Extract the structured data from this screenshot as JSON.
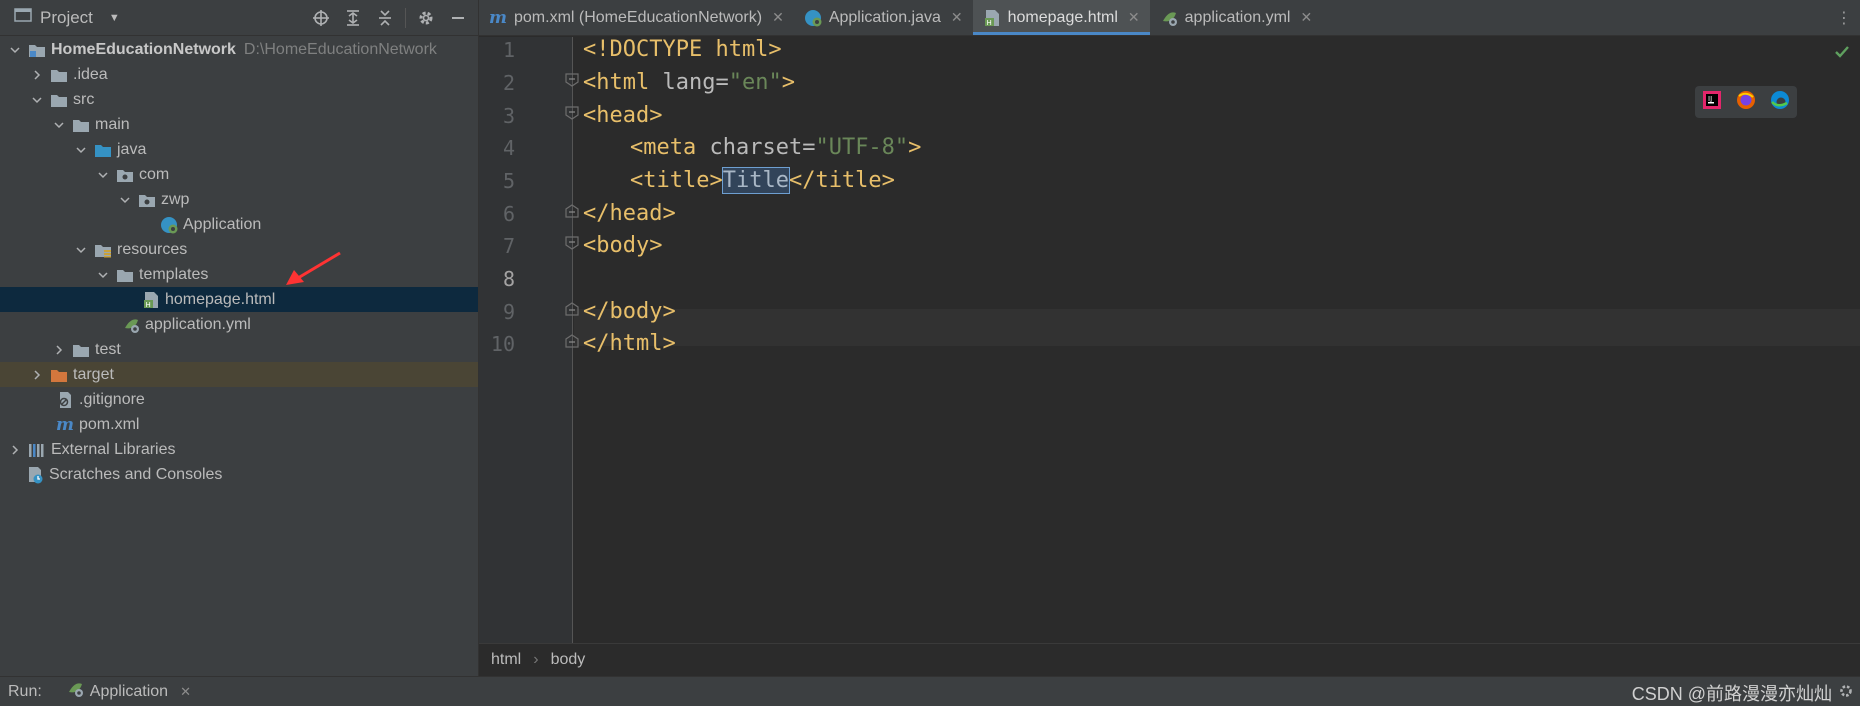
{
  "project_pane": {
    "title": "Project",
    "tools": [
      "locate-icon",
      "expand-all-icon",
      "collapse-all-icon",
      "gear-icon",
      "hide-icon"
    ],
    "tree": [
      {
        "label": "HomeEducationNetwork",
        "hint": "D:\\HomeEducationNetwork",
        "icon": "module-folder-icon"
      },
      {
        "label": ".idea",
        "icon": "folder-icon"
      },
      {
        "label": "src",
        "icon": "folder-icon"
      },
      {
        "label": "main",
        "icon": "folder-icon"
      },
      {
        "label": "java",
        "icon": "source-folder-icon"
      },
      {
        "label": "com",
        "icon": "package-icon"
      },
      {
        "label": "zwp",
        "icon": "package-icon"
      },
      {
        "label": "Application",
        "icon": "spring-boot-class-icon"
      },
      {
        "label": "resources",
        "icon": "resources-folder-icon"
      },
      {
        "label": "templates",
        "icon": "folder-icon"
      },
      {
        "label": "homepage.html",
        "icon": "html-file-icon"
      },
      {
        "label": "application.yml",
        "icon": "yaml-file-icon"
      },
      {
        "label": "test",
        "icon": "folder-icon"
      },
      {
        "label": "target",
        "icon": "excluded-folder-icon"
      },
      {
        "label": ".gitignore",
        "icon": "gitignore-file-icon"
      },
      {
        "label": "pom.xml",
        "icon": "maven-icon"
      },
      {
        "label": "External Libraries",
        "icon": "libraries-icon"
      },
      {
        "label": "Scratches and Consoles",
        "icon": "scratches-icon"
      }
    ]
  },
  "tabs": [
    {
      "label": "pom.xml (HomeEducationNetwork)",
      "icon": "maven-icon",
      "active": false
    },
    {
      "label": "Application.java",
      "icon": "spring-boot-class-icon",
      "active": false
    },
    {
      "label": "homepage.html",
      "icon": "html-file-icon",
      "active": true
    },
    {
      "label": "application.yml",
      "icon": "yaml-file-icon",
      "active": false
    }
  ],
  "editor": {
    "line_numbers": [
      "1",
      "2",
      "3",
      "4",
      "5",
      "6",
      "7",
      "8",
      "9",
      "10"
    ],
    "current_line": "8",
    "code": {
      "l1_tag": "<!DOCTYPE html>",
      "l2_open": "<html",
      "l2_attr": " lang=",
      "l2_val": "\"en\"",
      "l2_close": ">",
      "l3": "<head>",
      "l4_open": "<meta",
      "l4_attr": " charset=",
      "l4_val": "\"UTF-8\"",
      "l4_close": ">",
      "l5_open": "<title>",
      "l5_text": "Title",
      "l5_close": "</title>",
      "l6": "</head>",
      "l7": "<body>",
      "l9": "</body>",
      "l10": "</html>"
    },
    "browser_icons": [
      "intellij-icon",
      "firefox-icon",
      "edge-icon"
    ]
  },
  "breadcrumbs": [
    "html",
    "body"
  ],
  "runbar": {
    "label": "Run:",
    "tab_label": "Application",
    "watermark": "CSDN @前路漫漫亦灿灿"
  },
  "colors": {
    "accent": "#4a88c7",
    "tag": "#e8bf6a",
    "string": "#6a8759",
    "selection": "#0d293e",
    "annotation_arrow": "#ff3333"
  }
}
